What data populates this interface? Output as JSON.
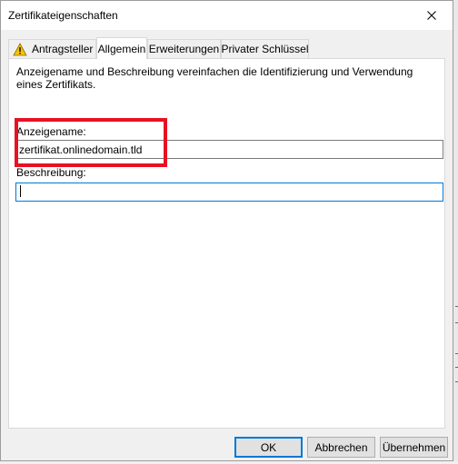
{
  "window": {
    "title": "Zertifikateigenschaften"
  },
  "tabs": [
    {
      "label": "Antragsteller",
      "icon": "warning-icon"
    },
    {
      "label": "Allgemein",
      "active": true
    },
    {
      "label": "Erweiterungen"
    },
    {
      "label": "Privater Schlüssel"
    }
  ],
  "general": {
    "description": "Anzeigename und Beschreibung vereinfachen die Identifizierung und Verwendung eines Zertifikats.",
    "display_name_label": "Anzeigename:",
    "display_name_value": "zertifikat.onlinedomain.tld",
    "description_label": "Beschreibung:",
    "description_value": ""
  },
  "buttons": {
    "ok": "OK",
    "cancel": "Abbrechen",
    "apply": "Übernehmen"
  },
  "colors": {
    "highlight": "#e81123",
    "focus": "#0078d7",
    "warning": "#f5c400"
  }
}
